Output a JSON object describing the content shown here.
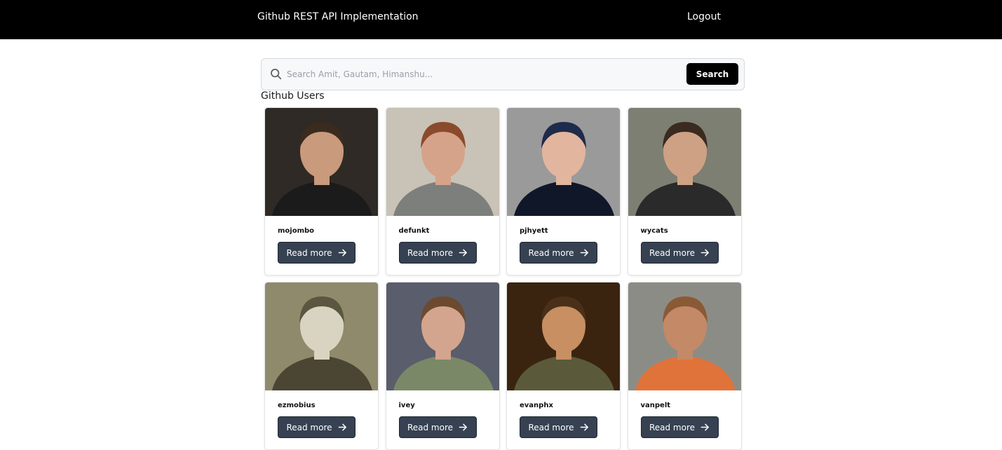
{
  "header": {
    "title": "Github REST API Implementation",
    "logout_label": "Logout"
  },
  "search": {
    "placeholder": "Search Amit, Gautam, Himanshu...",
    "button_label": "Search"
  },
  "section": {
    "title": "Github Users"
  },
  "card": {
    "button_label": "Read more"
  },
  "users": [
    {
      "login": "mojombo",
      "bg": "#2f2a25",
      "skin": "#c99a7c",
      "hair": "#3b2a1e",
      "shirt": "#1b1b1b"
    },
    {
      "login": "defunkt",
      "bg": "#c9c2b6",
      "skin": "#d4a38a",
      "hair": "#8a4a2b",
      "shirt": "#7d7f7c"
    },
    {
      "login": "pjhyett",
      "bg": "#9a9a9a",
      "skin": "#e2b59f",
      "hair": "#1f2b4a",
      "shirt": "#101728"
    },
    {
      "login": "wycats",
      "bg": "#7d7f73",
      "skin": "#cfa184",
      "hair": "#3a2a1f",
      "shirt": "#2a2a2a"
    },
    {
      "login": "ezmobius",
      "bg": "#8f8a6b",
      "skin": "#d8d4c1",
      "hair": "#5a5640",
      "shirt": "#4a4633"
    },
    {
      "login": "ivey",
      "bg": "#5a5d6b",
      "skin": "#d3a58e",
      "hair": "#6b4a2e",
      "shirt": "#7a8868"
    },
    {
      "login": "evanphx",
      "bg": "#3a2410",
      "skin": "#c78f62",
      "hair": "#4a3018",
      "shirt": "#5a5a3a"
    },
    {
      "login": "vanpelt",
      "bg": "#8c8c86",
      "skin": "#c48966",
      "hair": "#8a5a36",
      "shirt": "#e0733a"
    }
  ]
}
